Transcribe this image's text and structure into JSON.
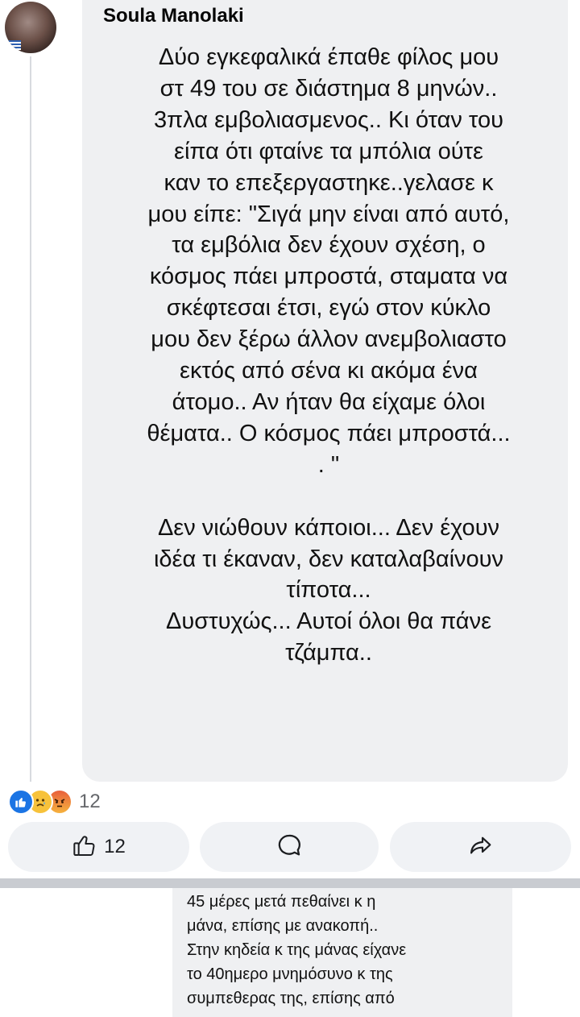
{
  "comment": {
    "author": "Soula Manolaki",
    "text": "Δύο εγκεφαλικά έπαθε φίλος μου\nστ 49 του σε διάστημα 8 μηνών..\n3πλα εμβολιασμενος.. Κι όταν του\nείπα ότι φταίνε τα μπόλια ούτε\nκαν το επεξεργαστηκε..γελασε κ\nμου είπε: \"Σιγά μην είναι από αυτό,\nτα εμβόλια δεν έχουν σχέση, ο\nκόσμος πάει μπροστά, σταματα να\nσκέφτεσαι έτσι, εγώ στον κύκλο\nμου δεν ξέρω άλλον ανεμβολιαστο\nεκτός από σένα κι ακόμα ένα\nάτομο.. Αν ήταν θα είχαμε όλοι\nθέματα.. Ο κόσμος πάει μπροστά...\n. \"\n\nΔεν νιώθουν κάποιοι... Δεν έχουν\nιδέα τι έκαναν, δεν καταλαβαίνουν\nτίποτα...\nΔυστυχώς... Αυτοί όλοι θα πάνε\nτζάμπα.."
  },
  "reactions": {
    "icons": [
      "like-icon",
      "sad-face-icon",
      "angry-face-icon"
    ],
    "count": "12"
  },
  "actions": {
    "like_count": "12",
    "like_icon": "thumbs-up-icon",
    "comment_icon": "speech-bubble-icon",
    "share_icon": "share-arrow-icon"
  },
  "next_comment": {
    "text": "45 μέρες μετά πεθαίνει κ η\nμάνα, επίσης με ανακοπή..\nΣτην κηδεία κ της μάνας είχανε\nτο 40ημερο μνημόσυνο κ της\nσυμπεθερας της, επίσης από"
  },
  "colors": {
    "bubble": "#eff0f2",
    "like_blue": "#1b74e4",
    "button_bg": "#f0f2f5",
    "separator": "#c9ccd1"
  }
}
